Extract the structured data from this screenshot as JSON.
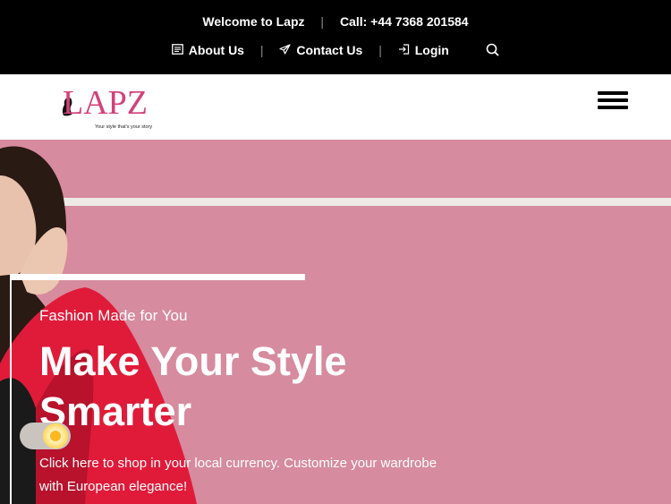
{
  "topbar": {
    "welcome": "Welcome to Lapz",
    "call": "Call: +44 7368 201584",
    "links": [
      {
        "label": "About Us",
        "icon": "document-icon"
      },
      {
        "label": "Contact Us",
        "icon": "paper-plane-icon"
      },
      {
        "label": "Login",
        "icon": "login-icon"
      }
    ],
    "search_icon": "search-icon"
  },
  "header": {
    "logo_text": "LAPZ",
    "logo_tagline": "Your style that's your story",
    "menu_icon": "hamburger-icon"
  },
  "hero": {
    "eyebrow": "Fashion Made for You",
    "title": "Make Your Style Smarter",
    "description": "Click here to shop in your local currency. Customize your wardrobe with European elegance!",
    "background_color": "#d68b9e"
  },
  "theme_toggle": {
    "icon": "sun-icon"
  },
  "colors": {
    "brand": "#d2417a",
    "topbar": "#000000"
  }
}
